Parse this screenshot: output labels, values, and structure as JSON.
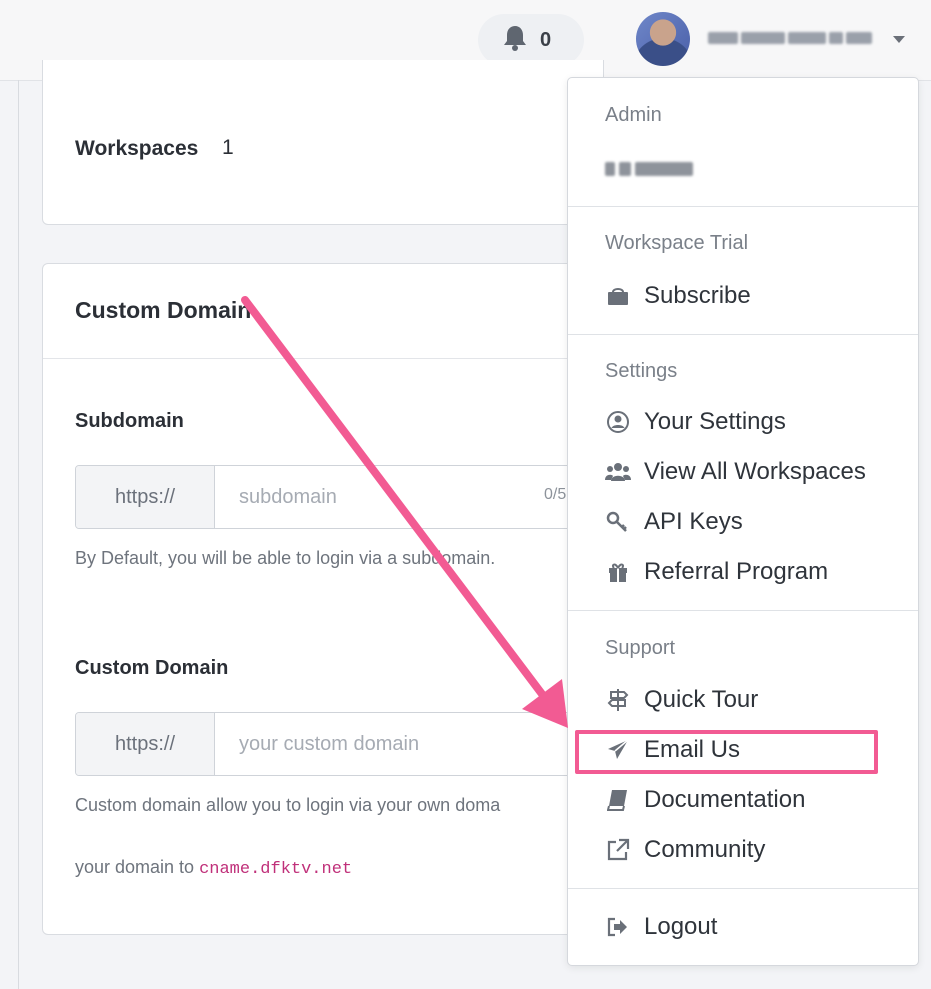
{
  "topbar": {
    "notification_count": "0",
    "user_menu_caret": "chevron-down-icon"
  },
  "workspaces_card": {
    "label": "Workspaces",
    "value": "1"
  },
  "custom_domain_card": {
    "title": "Custom Domain",
    "subdomain": {
      "label": "Subdomain",
      "prefix": "https://",
      "placeholder": "subdomain",
      "counter": "0/5",
      "help": "By Default, you will be able to login via a subdomain."
    },
    "custom_domain": {
      "label": "Custom Domain",
      "prefix": "https://",
      "placeholder": "your custom domain",
      "help_line1": "Custom domain allow you to login via your own doma",
      "help_line2_prefix": "your domain to ",
      "help_line2_code": "cname.dfktv.net"
    }
  },
  "dropdown": {
    "sections": {
      "admin": "Admin",
      "workspace_trial": "Workspace Trial",
      "settings": "Settings",
      "support": "Support"
    },
    "items": {
      "subscribe": "Subscribe",
      "your_settings": "Your Settings",
      "view_all_workspaces": "View All Workspaces",
      "api_keys": "API Keys",
      "referral_program": "Referral Program",
      "quick_tour": "Quick Tour",
      "email_us": "Email Us",
      "documentation": "Documentation",
      "community": "Community",
      "logout": "Logout"
    }
  },
  "annotation": {
    "highlight_color": "#f25b93",
    "target": "email_us"
  }
}
